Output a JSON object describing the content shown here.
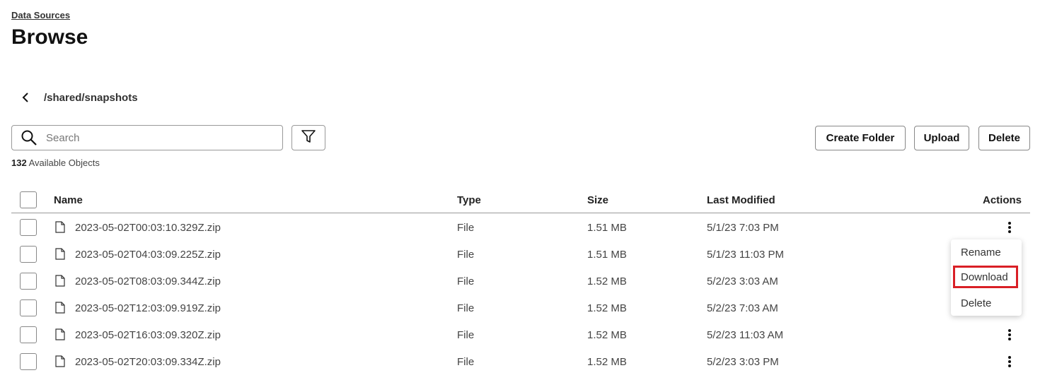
{
  "breadcrumb": "Data Sources",
  "page_title": "Browse",
  "path": "/shared/snapshots",
  "search": {
    "placeholder": "Search"
  },
  "toolbar": {
    "create_folder": "Create Folder",
    "upload": "Upload",
    "delete": "Delete"
  },
  "summary": {
    "count": "132",
    "label": "Available Objects"
  },
  "table": {
    "headers": {
      "name": "Name",
      "type": "Type",
      "size": "Size",
      "modified": "Last Modified",
      "actions": "Actions"
    },
    "rows": [
      {
        "name": "2023-05-02T00:03:10.329Z.zip",
        "type": "File",
        "size": "1.51 MB",
        "modified": "5/1/23 7:03 PM"
      },
      {
        "name": "2023-05-02T04:03:09.225Z.zip",
        "type": "File",
        "size": "1.51 MB",
        "modified": "5/1/23 11:03 PM"
      },
      {
        "name": "2023-05-02T08:03:09.344Z.zip",
        "type": "File",
        "size": "1.52 MB",
        "modified": "5/2/23 3:03 AM"
      },
      {
        "name": "2023-05-02T12:03:09.919Z.zip",
        "type": "File",
        "size": "1.52 MB",
        "modified": "5/2/23 7:03 AM"
      },
      {
        "name": "2023-05-02T16:03:09.320Z.zip",
        "type": "File",
        "size": "1.52 MB",
        "modified": "5/2/23 11:03 AM"
      },
      {
        "name": "2023-05-02T20:03:09.334Z.zip",
        "type": "File",
        "size": "1.52 MB",
        "modified": "5/2/23 3:03 PM"
      }
    ]
  },
  "context_menu": {
    "items": [
      "Rename",
      "Download",
      "Delete"
    ],
    "highlighted": "Download",
    "highlight_color": "#d91f26"
  },
  "icons": {
    "back": "chevron-left-icon",
    "search": "search-icon",
    "filter": "filter-icon",
    "file": "file-icon",
    "actions": "kebab-menu-icon"
  }
}
